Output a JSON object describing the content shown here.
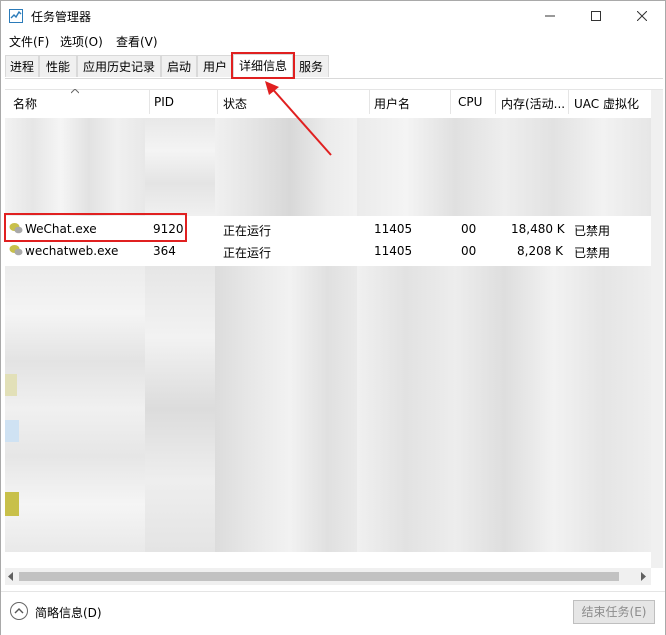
{
  "window": {
    "title": "任务管理器"
  },
  "menu": {
    "file": "文件(F)",
    "options": "选项(O)",
    "view": "查看(V)"
  },
  "tabs": [
    "进程",
    "性能",
    "应用历史记录",
    "启动",
    "用户",
    "详细信息",
    "服务"
  ],
  "active_tab": "详细信息",
  "columns": {
    "name": "名称",
    "pid": "PID",
    "status": "状态",
    "user": "用户名",
    "cpu": "CPU",
    "memory": "内存(活动...",
    "uac": "UAC 虚拟化"
  },
  "rows": [
    {
      "name": "WeChat.exe",
      "pid": "9120",
      "status": "正在运行",
      "user": "11405",
      "cpu": "00",
      "memory": "18,480 K",
      "uac": "已禁用"
    },
    {
      "name": "wechatweb.exe",
      "pid": "364",
      "status": "正在运行",
      "user": "11405",
      "cpu": "00",
      "memory": "8,208 K",
      "uac": "已禁用"
    }
  ],
  "footer": {
    "fewer_details": "简略信息(D)",
    "end_task": "结束任务(E)"
  },
  "colors": {
    "highlight": "#e02020",
    "icon_yellow": "#c8c04a"
  },
  "icons": {
    "app": "task-manager-icon",
    "process": "wechat-icon",
    "collapse": "chevron-up-icon"
  }
}
